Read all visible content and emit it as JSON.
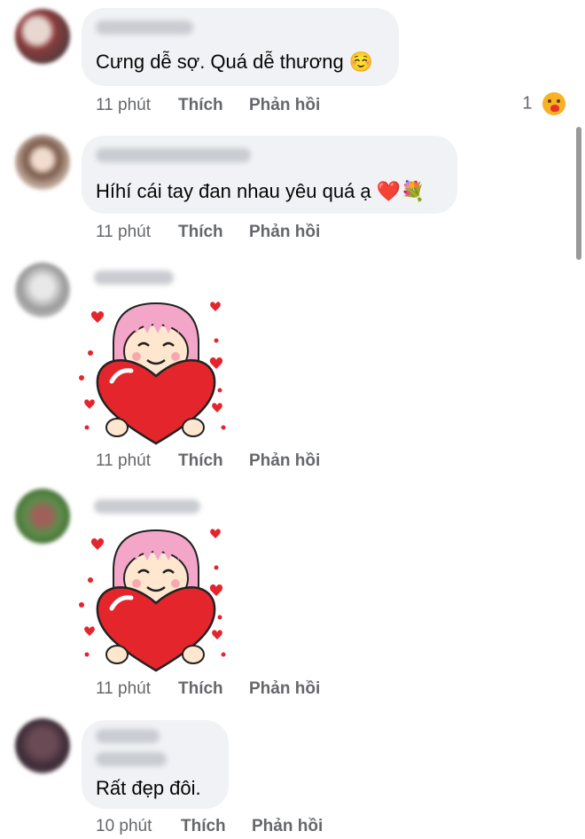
{
  "comments": [
    {
      "text": "Cưng dễ sợ. Quá dễ thương",
      "emoji": "☺️",
      "time": "11 phút",
      "like": "Thích",
      "reply": "Phản hồi",
      "reaction_count": "1",
      "reaction_icon": "care-reaction-icon"
    },
    {
      "text": "Híhí cái tay đan nhau yêu quá ạ",
      "emoji": "❤️💐",
      "time": "11 phút",
      "like": "Thích",
      "reply": "Phản hồi"
    },
    {
      "sticker": "girl-holding-heart-sticker",
      "time": "11 phút",
      "like": "Thích",
      "reply": "Phản hồi"
    },
    {
      "sticker": "girl-holding-heart-sticker",
      "time": "11 phút",
      "like": "Thích",
      "reply": "Phản hồi"
    },
    {
      "text": "Rất đẹp đôi.",
      "time": "10 phút",
      "like": "Thích",
      "reply": "Phản hồi"
    }
  ],
  "colors": {
    "bubble": "#f0f2f5",
    "meta_text": "#65676b",
    "heart": "#e4262c",
    "hair": "#f4a6c8"
  }
}
